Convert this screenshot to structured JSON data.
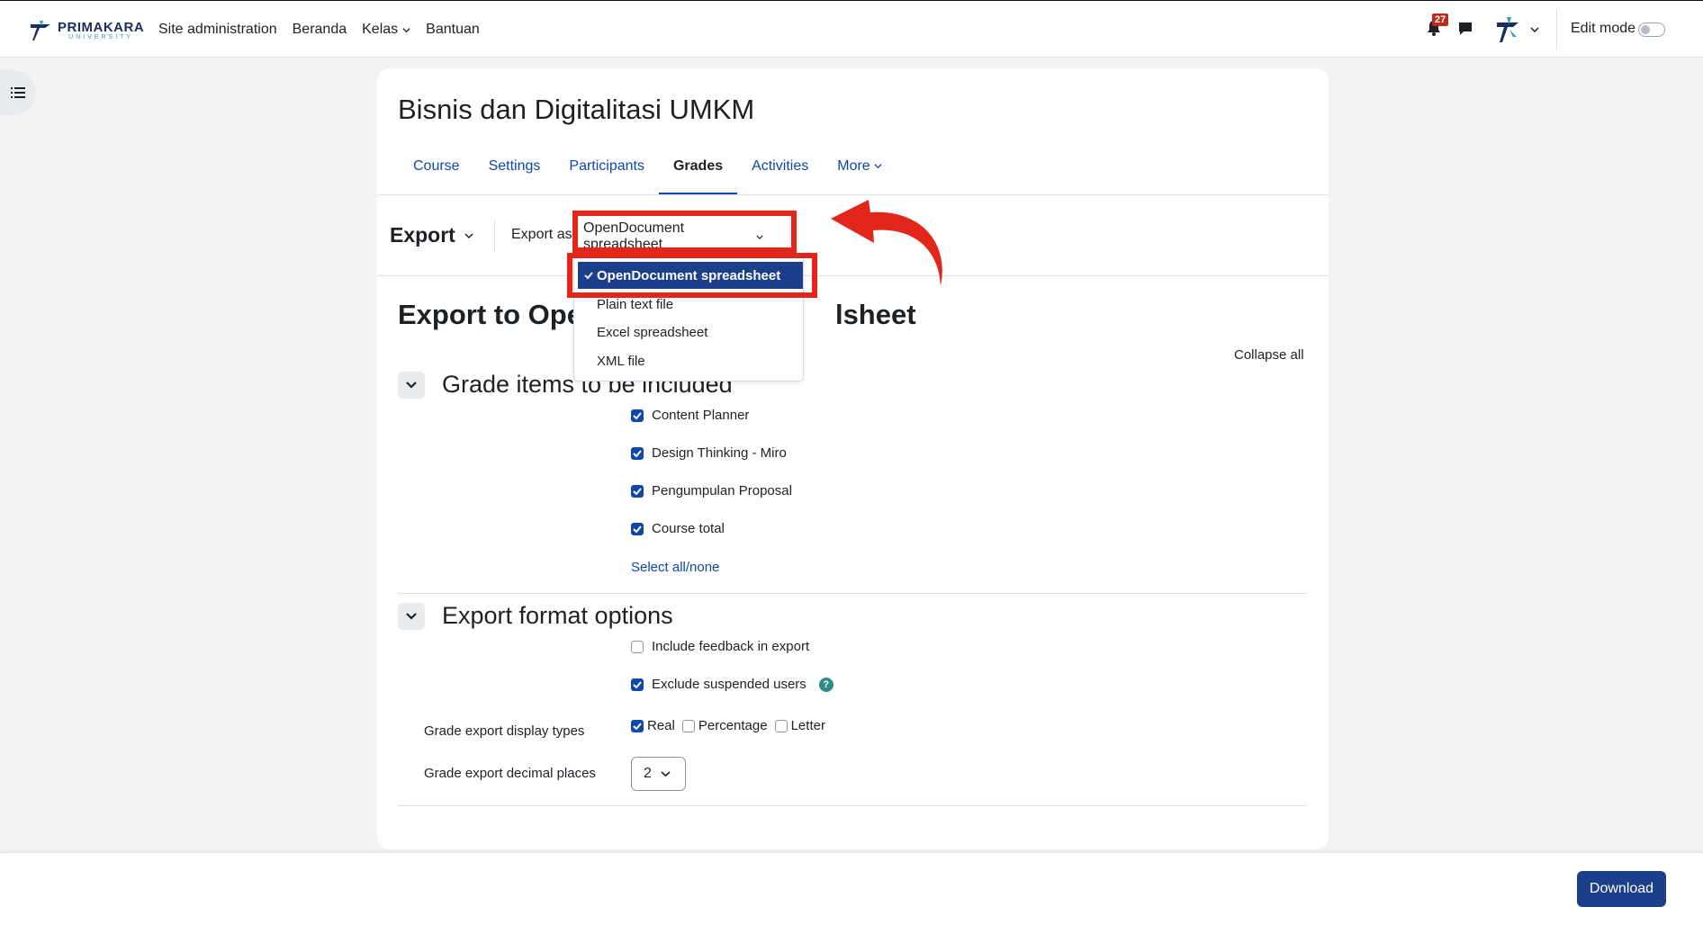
{
  "header": {
    "logo_brand": "PRIMAKARA",
    "logo_sub": "UNIVERSITY",
    "nav": [
      {
        "label": "Site administration"
      },
      {
        "label": "Beranda"
      },
      {
        "label": "Kelas"
      },
      {
        "label": "Bantuan"
      }
    ],
    "notification_count": "27",
    "edit_mode_label": "Edit mode",
    "edit_mode_on": false,
    "icons": [
      "bell-icon",
      "chat-icon",
      "user-avatar",
      "chevron-down-icon",
      "list-icon"
    ]
  },
  "course": {
    "title": "Bisnis dan Digitalitasi UMKM",
    "tabs": [
      {
        "label": "Course"
      },
      {
        "label": "Settings"
      },
      {
        "label": "Participants"
      },
      {
        "label": "Grades",
        "active": true
      },
      {
        "label": "Activities"
      },
      {
        "label": "More"
      }
    ]
  },
  "export_bar": {
    "heading": "Export",
    "export_as_label": "Export as",
    "selected_format": "OpenDocument spreadsheet"
  },
  "dropdown": {
    "options": [
      {
        "label": "OpenDocument spreadsheet",
        "selected": true
      },
      {
        "label": "Plain text file"
      },
      {
        "label": "Excel spreadsheet"
      },
      {
        "label": "XML file"
      }
    ]
  },
  "page": {
    "heading_left": "Export to Ope",
    "heading_right": "lsheet",
    "collapse_all": "Collapse all"
  },
  "grade_items": {
    "title": "Grade items to be included",
    "items": [
      {
        "label": "Content Planner",
        "checked": true
      },
      {
        "label": "Design Thinking - Miro",
        "checked": true
      },
      {
        "label": "Pengumpulan Proposal",
        "checked": true
      },
      {
        "label": "Course total",
        "checked": true
      }
    ],
    "select_all": "Select all/none"
  },
  "format_options": {
    "title": "Export format options",
    "include_feedback": {
      "label": "Include feedback in export",
      "checked": false
    },
    "exclude_suspended": {
      "label": "Exclude suspended users",
      "checked": true
    },
    "help_glyph": "?",
    "display_types_label": "Grade export display types",
    "display_types": [
      {
        "label": "Real",
        "checked": true
      },
      {
        "label": "Percentage",
        "checked": false
      },
      {
        "label": "Letter",
        "checked": false
      }
    ],
    "decimal_label": "Grade export decimal places",
    "decimal_value": "2"
  },
  "footer": {
    "download_label": "Download"
  },
  "colors": {
    "primary": "#0f47ad",
    "selected_bg": "#1b3f8a",
    "annotation": "#e3261b",
    "badge": "#c12a1a"
  }
}
